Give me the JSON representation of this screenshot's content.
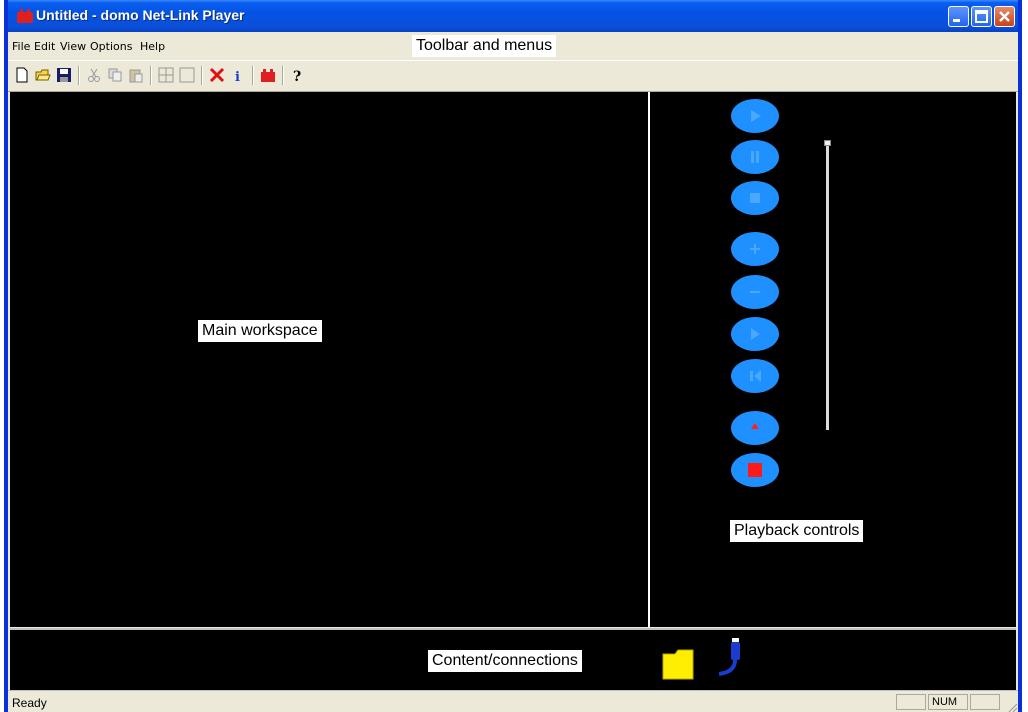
{
  "window": {
    "title": "Untitled - domo Net-Link Player"
  },
  "menu": [
    "File",
    "Edit",
    "View",
    "Options",
    "Help"
  ],
  "toolbar": {
    "buttons": [
      "new-icon",
      "open-icon",
      "save-icon",
      "cut-icon",
      "copy-icon",
      "paste-icon",
      "grid-icon",
      "blank-icon",
      "delete-icon",
      "info-icon",
      "record-icon",
      "help-icon"
    ]
  },
  "annotations": {
    "toolbar_menus": "Toolbar and menus",
    "main_workspace": "Main workspace",
    "playback_controls": "Playback controls",
    "content_connections": "Content/connections"
  },
  "playback": {
    "buttons": [
      "play-icon",
      "pause-icon",
      "stop-icon",
      "plus-icon",
      "minus-icon",
      "forward-icon",
      "rewind-icon",
      "up-arrow-icon",
      "record-stop-icon"
    ]
  },
  "status": {
    "text": "Ready",
    "num": "NUM"
  },
  "colors": {
    "title_bar": "#0453e5",
    "button_blue": "#1e90ff",
    "stop_red": "#ff1a1a",
    "folder_yellow": "#ffee00"
  }
}
